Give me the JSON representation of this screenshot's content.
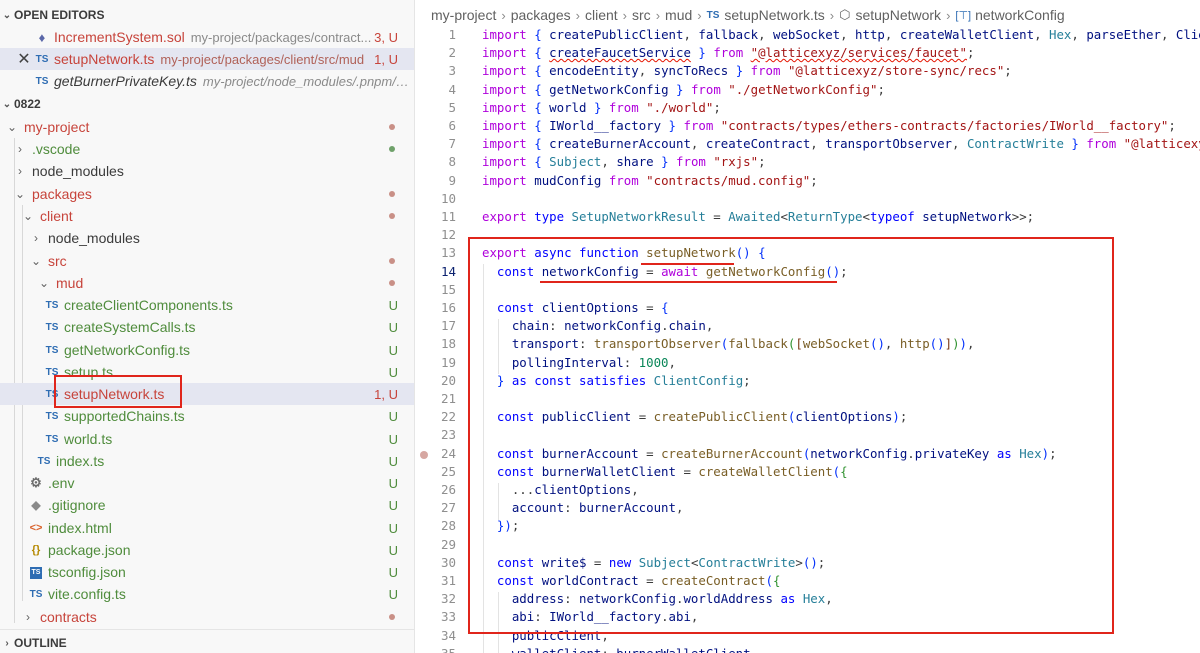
{
  "sidebar": {
    "open_editors": {
      "title": "OPEN EDITORS",
      "items": [
        {
          "name": "IncrementSystem.sol",
          "path": "my-project/packages/contract...",
          "badge": "3, U",
          "icon": "sol"
        },
        {
          "name": "setupNetwork.ts",
          "path": "my-project/packages/client/src/mud",
          "badge": "1, U",
          "icon": "TS"
        },
        {
          "name": "getBurnerPrivateKey.ts",
          "path": "my-project/node_modules/.pnpm/@...",
          "badge": "",
          "icon": "TS"
        }
      ]
    },
    "explorer": {
      "title": "0822",
      "items": [
        {
          "name": "my-project",
          "twisty": "open",
          "badge": ""
        },
        {
          "name": ".vscode",
          "twisty": "closed",
          "badge": ""
        },
        {
          "name": "node_modules",
          "twisty": "closed",
          "badge": ""
        },
        {
          "name": "packages",
          "twisty": "open",
          "badge": ""
        },
        {
          "name": "client",
          "twisty": "open",
          "badge": ""
        },
        {
          "name": "node_modules",
          "twisty": "closed",
          "badge": ""
        },
        {
          "name": "src",
          "twisty": "open",
          "badge": ""
        },
        {
          "name": "mud",
          "twisty": "open",
          "badge": ""
        },
        {
          "name": "createClientComponents.ts",
          "icon": "TS",
          "badge": "U"
        },
        {
          "name": "createSystemCalls.ts",
          "icon": "TS",
          "badge": "U"
        },
        {
          "name": "getNetworkConfig.ts",
          "icon": "TS",
          "badge": "U"
        },
        {
          "name": "setup.ts",
          "icon": "TS",
          "badge": "U"
        },
        {
          "name": "setupNetwork.ts",
          "icon": "TS",
          "badge": "1, U"
        },
        {
          "name": "supportedChains.ts",
          "icon": "TS",
          "badge": "U"
        },
        {
          "name": "world.ts",
          "icon": "TS",
          "badge": "U"
        },
        {
          "name": "index.ts",
          "icon": "TS",
          "badge": "U"
        },
        {
          "name": ".env",
          "icon": "gear",
          "badge": "U"
        },
        {
          "name": ".gitignore",
          "icon": "git",
          "badge": "U"
        },
        {
          "name": "index.html",
          "icon": "html",
          "badge": "U"
        },
        {
          "name": "package.json",
          "icon": "json",
          "badge": "U"
        },
        {
          "name": "tsconfig.json",
          "icon": "tsconfig",
          "badge": "U"
        },
        {
          "name": "vite.config.ts",
          "icon": "TS",
          "badge": "U"
        },
        {
          "name": "contracts",
          "twisty": "closed",
          "badge": ""
        }
      ]
    },
    "outline_title": "OUTLINE"
  },
  "editor": {
    "breadcrumb": [
      "my-project",
      "packages",
      "client",
      "src",
      "mud",
      "setupNetwork.ts",
      "setupNetwork",
      "networkConfig"
    ],
    "breadcrumb_file_icon": "TS",
    "current_line": 14,
    "lines": [
      {
        "n": "1",
        "text": "import { createPublicClient, fallback, webSocket, http, createWalletClient, Hex, parseEther, Clien"
      },
      {
        "n": "2",
        "text": "import { createFaucetService } from \"@latticexyz/services/faucet\";"
      },
      {
        "n": "3",
        "text": "import { encodeEntity, syncToRecs } from \"@latticexyz/store-sync/recs\";"
      },
      {
        "n": "4",
        "text": "import { getNetworkConfig } from \"./getNetworkConfig\";"
      },
      {
        "n": "5",
        "text": "import { world } from \"./world\";"
      },
      {
        "n": "6",
        "text": "import { IWorld__factory } from \"contracts/types/ethers-contracts/factories/IWorld__factory\";"
      },
      {
        "n": "7",
        "text": "import { createBurnerAccount, createContract, transportObserver, ContractWrite } from \"@latticexyz"
      },
      {
        "n": "8",
        "text": "import { Subject, share } from \"rxjs\";"
      },
      {
        "n": "9",
        "text": "import mudConfig from \"contracts/mud.config\";"
      },
      {
        "n": "10",
        "text": ""
      },
      {
        "n": "11",
        "text": "export type SetupNetworkResult = Awaited<ReturnType<typeof setupNetwork>>;"
      },
      {
        "n": "12",
        "text": ""
      },
      {
        "n": "13",
        "text": "export async function setupNetwork() {"
      },
      {
        "n": "14",
        "text": "  const networkConfig = await getNetworkConfig();"
      },
      {
        "n": "15",
        "text": ""
      },
      {
        "n": "16",
        "text": "  const clientOptions = {"
      },
      {
        "n": "17",
        "text": "    chain: networkConfig.chain,"
      },
      {
        "n": "18",
        "text": "    transport: transportObserver(fallback([webSocket(), http()])),"
      },
      {
        "n": "19",
        "text": "    pollingInterval: 1000,"
      },
      {
        "n": "20",
        "text": "  } as const satisfies ClientConfig;"
      },
      {
        "n": "21",
        "text": ""
      },
      {
        "n": "22",
        "text": "  const publicClient = createPublicClient(clientOptions);"
      },
      {
        "n": "23",
        "text": ""
      },
      {
        "n": "24",
        "text": "  const burnerAccount = createBurnerAccount(networkConfig.privateKey as Hex);"
      },
      {
        "n": "25",
        "text": "  const burnerWalletClient = createWalletClient({"
      },
      {
        "n": "26",
        "text": "    ...clientOptions,"
      },
      {
        "n": "27",
        "text": "    account: burnerAccount,"
      },
      {
        "n": "28",
        "text": "  });"
      },
      {
        "n": "29",
        "text": ""
      },
      {
        "n": "30",
        "text": "  const write$ = new Subject<ContractWrite>();"
      },
      {
        "n": "31",
        "text": "  const worldContract = createContract({"
      },
      {
        "n": "32",
        "text": "    address: networkConfig.worldAddress as Hex,"
      },
      {
        "n": "33",
        "text": "    abi: IWorld__factory.abi,"
      },
      {
        "n": "34",
        "text": "    publicClient,"
      },
      {
        "n": "35",
        "text": "    walletClient: burnerWalletClient,"
      }
    ]
  },
  "colors": {
    "highlight_box": "#e0251b",
    "modified_red": "#c7443b",
    "untracked_green": "#4f8c3c",
    "selection_bg": "#e4e6f1"
  }
}
